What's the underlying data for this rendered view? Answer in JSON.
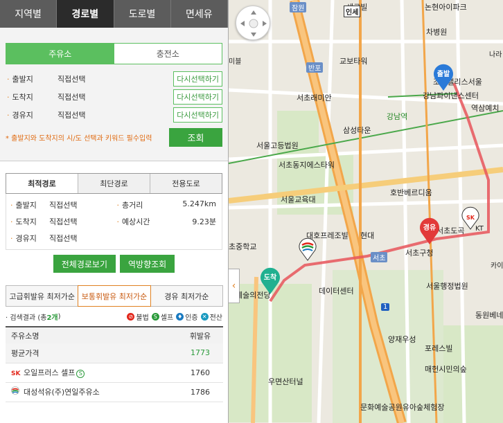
{
  "top_tabs": [
    "지역별",
    "경로별",
    "도로별",
    "면세유"
  ],
  "fuel_tabs": [
    "주유소",
    "충전소"
  ],
  "selections": [
    {
      "label": "출발지",
      "value": "직접선택",
      "button": "다시선택하기"
    },
    {
      "label": "도착지",
      "value": "직접선택",
      "button": "다시선택하기"
    },
    {
      "label": "경유지",
      "value": "직접선택",
      "button": "다시선택하기"
    }
  ],
  "notice": "* 출발지와 도착지의 시/도 선택과 키워드 필수입력",
  "search_label": "조회",
  "route_tabs": [
    "최적경로",
    "최단경로",
    "전용도로"
  ],
  "route_info": {
    "start_label": "출발지",
    "start_value": "직접선택",
    "end_label": "도착지",
    "end_value": "직접선택",
    "via_label": "경유지",
    "via_value": "직접선택",
    "distance_label": "총거리",
    "distance_value": "5.247km",
    "time_label": "예상시간",
    "time_value": "9.23분"
  },
  "route_buttons": {
    "full": "전체경로보기",
    "reverse": "역방향조회"
  },
  "price_tabs": [
    "고급휘발유 최저가순",
    "보통휘발유 최저가순",
    "경유 최저가순"
  ],
  "result": {
    "prefix": "· 검색결과 (총 ",
    "count": "2개",
    "suffix": ")"
  },
  "legend": [
    {
      "icon": "illegal-icon",
      "label": "불법",
      "glyph": "⊘",
      "color": "#e2261a"
    },
    {
      "icon": "self-icon",
      "label": "셀프",
      "glyph": "S",
      "color": "#2a9a3a"
    },
    {
      "icon": "certified-icon",
      "label": "인증",
      "glyph": "♦",
      "color": "#1a7ac0"
    },
    {
      "icon": "electronic-icon",
      "label": "전산",
      "glyph": "✕",
      "color": "#1a9ac0"
    }
  ],
  "table": {
    "headers": [
      "주유소명",
      "휘발유"
    ],
    "average": {
      "name": "평균가격",
      "price": "1773"
    },
    "rows": [
      {
        "brand": "SK",
        "name": "오일프러스 셀프",
        "self": "S",
        "price": "1760"
      },
      {
        "brand": "",
        "name": "대성석유(주)연일주유소",
        "self": "",
        "price": "1786"
      }
    ]
  },
  "map": {
    "pins": {
      "start": "출발",
      "end": "도착",
      "via": "경유"
    },
    "road_badges": [
      "잠원",
      "반포",
      "서초",
      "인세"
    ],
    "labels": [
      {
        "text": "세르빌",
        "cls": ""
      },
      {
        "text": "논현아이파크",
        "cls": ""
      },
      {
        "text": "차병원",
        "cls": ""
      },
      {
        "text": "교보타워",
        "cls": ""
      },
      {
        "text": "조선팰리스서울",
        "cls": ""
      },
      {
        "text": "강남파이낸스센터",
        "cls": ""
      },
      {
        "text": "나라",
        "cls": ""
      },
      {
        "text": "역삼예치",
        "cls": ""
      },
      {
        "text": "서초래미안",
        "cls": ""
      },
      {
        "text": "강남역",
        "cls": ""
      },
      {
        "text": "삼성타운",
        "cls": ""
      },
      {
        "text": "서울고등법원",
        "cls": ""
      },
      {
        "text": "서초동지에스타워",
        "cls": ""
      },
      {
        "text": "호반베르디움",
        "cls": ""
      },
      {
        "text": "서울교육대",
        "cls": ""
      },
      {
        "text": "대호프레조빌",
        "cls": ""
      },
      {
        "text": "현대",
        "cls": ""
      },
      {
        "text": "서초도곡",
        "cls": ""
      },
      {
        "text": "서초구청",
        "cls": ""
      },
      {
        "text": "서울행정법원",
        "cls": ""
      },
      {
        "text": "초중학교",
        "cls": ""
      },
      {
        "text": "예술의전당",
        "cls": ""
      },
      {
        "text": "데이터센터",
        "cls": ""
      },
      {
        "text": "양재우성",
        "cls": ""
      },
      {
        "text": "포레스빌",
        "cls": ""
      },
      {
        "text": "동원베네",
        "cls": ""
      },
      {
        "text": "매헌시민의숲",
        "cls": ""
      },
      {
        "text": "우면산터널",
        "cls": ""
      },
      {
        "text": "문화예술공원유아숲체험장",
        "cls": ""
      },
      {
        "text": "미블",
        "cls": "small"
      },
      {
        "text": "카이",
        "cls": "small"
      },
      {
        "text": "KT",
        "cls": "small"
      },
      {
        "text": "1",
        "cls": "small"
      }
    ]
  }
}
